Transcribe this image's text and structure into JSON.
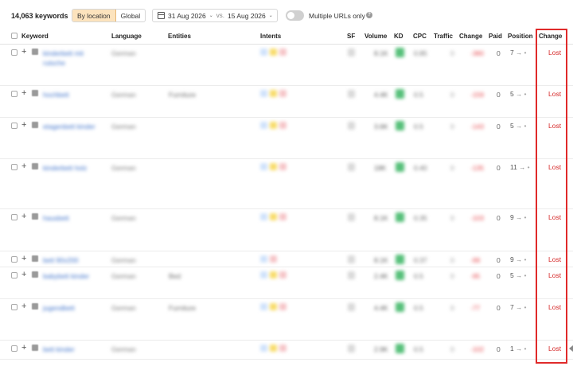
{
  "toolbar": {
    "keyword_count": "14,063 keywords",
    "by_location": "By location",
    "global": "Global",
    "date_from": "31 Aug 2026",
    "vs": "vs.",
    "date_to": "15 Aug 2026",
    "multiple_urls": "Multiple URLs only"
  },
  "columns": {
    "keyword": "Keyword",
    "language": "Language",
    "entities": "Entities",
    "intents": "Intents",
    "sf": "SF",
    "volume": "Volume",
    "kd": "KD",
    "cpc": "CPC",
    "traffic": "Traffic",
    "change": "Change",
    "paid": "Paid",
    "position": "Position",
    "change2": "Change"
  },
  "colors": {
    "intent_blue": "#cfe2fb",
    "intent_yellow": "#f8dc6b",
    "intent_red": "#f6c5c8",
    "kd_green": "#57c07a",
    "lost_red": "#d62b2b",
    "highlight": "#e02a2a"
  },
  "rows": [
    {
      "keyword": "kinderbett mit rutsche",
      "language": "German",
      "entities": "",
      "intents": [
        "blue",
        "yellow",
        "red"
      ],
      "volume": "8.1K",
      "cpc": "0.85",
      "traffic": "0",
      "change": "-380",
      "paid": "0",
      "position": "7",
      "status": "Lost"
    },
    {
      "keyword": "hochbett",
      "language": "German",
      "entities": "Furniture",
      "intents": [
        "blue",
        "yellow",
        "red"
      ],
      "volume": "4.4K",
      "cpc": "0.5",
      "traffic": "0",
      "change": "-159",
      "paid": "0",
      "position": "5",
      "status": "Lost"
    },
    {
      "keyword": "etagenbett kinder",
      "language": "German",
      "entities": "",
      "intents": [
        "blue",
        "yellow",
        "red"
      ],
      "volume": "3.6K",
      "cpc": "0.5",
      "traffic": "0",
      "change": "-143",
      "paid": "0",
      "position": "5",
      "status": "Lost"
    },
    {
      "keyword": "kinderbett holz",
      "language": "German",
      "entities": "",
      "intents": [
        "blue",
        "yellow",
        "red"
      ],
      "volume": "18K",
      "cpc": "0.40",
      "traffic": "0",
      "change": "-135",
      "paid": "0",
      "position": "11",
      "status": "Lost"
    },
    {
      "keyword": "hausbett",
      "language": "German",
      "entities": "",
      "intents": [
        "blue",
        "yellow",
        "red"
      ],
      "volume": "8.1K",
      "cpc": "0.35",
      "traffic": "0",
      "change": "-103",
      "paid": "0",
      "position": "9",
      "status": "Lost"
    },
    {
      "keyword": "bett 90x200",
      "language": "German",
      "entities": "",
      "intents": [
        "blue",
        "red"
      ],
      "volume": "8.1K",
      "cpc": "0.37",
      "traffic": "0",
      "change": "-99",
      "paid": "0",
      "position": "9",
      "status": "Lost"
    },
    {
      "keyword": "babybett kinder",
      "language": "German",
      "entities": "Bed",
      "intents": [
        "blue",
        "yellow",
        "red"
      ],
      "volume": "2.4K",
      "cpc": "0.5",
      "traffic": "0",
      "change": "-95",
      "paid": "0",
      "position": "5",
      "status": "Lost"
    },
    {
      "keyword": "jugendbett",
      "language": "German",
      "entities": "Furniture",
      "intents": [
        "blue",
        "yellow",
        "red"
      ],
      "volume": "4.4K",
      "cpc": "0.5",
      "traffic": "0",
      "change": "-77",
      "paid": "0",
      "position": "7",
      "status": "Lost"
    },
    {
      "keyword": "bett kinder",
      "language": "German",
      "entities": "",
      "intents": [
        "blue",
        "yellow",
        "red"
      ],
      "volume": "2.9K",
      "cpc": "0.5",
      "traffic": "0",
      "change": "-102",
      "paid": "0",
      "position": "1",
      "status": "Lost"
    }
  ]
}
